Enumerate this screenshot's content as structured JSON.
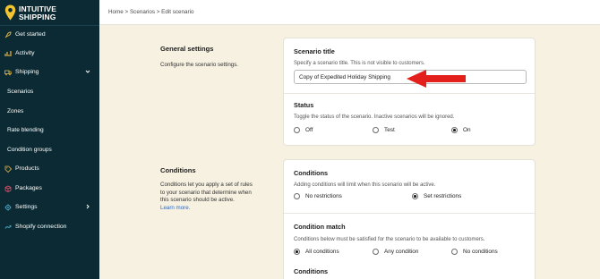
{
  "brand": {
    "logo_line1": "INTUITIVE",
    "logo_line2": "SHIPPING",
    "pin_color": "#f4c430"
  },
  "sidebar": {
    "items": [
      {
        "label": "Get started",
        "icon": "rocket-icon"
      },
      {
        "label": "Activity",
        "icon": "chart-icon"
      },
      {
        "label": "Shipping",
        "icon": "truck-icon"
      },
      {
        "label": "Scenarios"
      },
      {
        "label": "Zones"
      },
      {
        "label": "Rate blending"
      },
      {
        "label": "Condition groups"
      },
      {
        "label": "Products",
        "icon": "tag-icon"
      },
      {
        "label": "Packages",
        "icon": "box-icon"
      },
      {
        "label": "Settings",
        "icon": "gear-icon"
      },
      {
        "label": "Shopify connection",
        "icon": "link-icon"
      }
    ]
  },
  "breadcrumb": "Home > Scenarios > Edit scenario",
  "general": {
    "title": "General settings",
    "desc": "Configure the scenario settings."
  },
  "scenario_title": {
    "label": "Scenario title",
    "desc": "Specify a scenario title. This is not visible to customers.",
    "value": "Copy of Expedited Holiday Shipping"
  },
  "status": {
    "label": "Status",
    "desc": "Toggle the status of the scenario. Inactive scenarios will be ignored.",
    "options": [
      "Off",
      "Test",
      "On"
    ],
    "selected": "On"
  },
  "conditions_section": {
    "title": "Conditions",
    "desc_line1": "Conditions let you apply a set of rules",
    "desc_line2": "to your scenario that determine when",
    "desc_line3": "this scenario should be active.",
    "learn_more": "Learn more."
  },
  "conditions_card": {
    "label": "Conditions",
    "desc": "Adding conditions will limit when this scenario will be active.",
    "options": [
      "No restrictions",
      "Set restrictions"
    ],
    "selected": "Set restrictions"
  },
  "condition_match": {
    "label": "Condition match",
    "desc": "Conditions below must be satisfied for the scenario to be available to customers.",
    "options": [
      "All conditions",
      "Any condition",
      "No conditions"
    ],
    "selected": "All conditions"
  },
  "conditions_sub_label": "Conditions",
  "colors": {
    "sidebar_bg": "#0b2a33",
    "page_bg": "#f6f1e1",
    "arrow": "#e3201b"
  }
}
